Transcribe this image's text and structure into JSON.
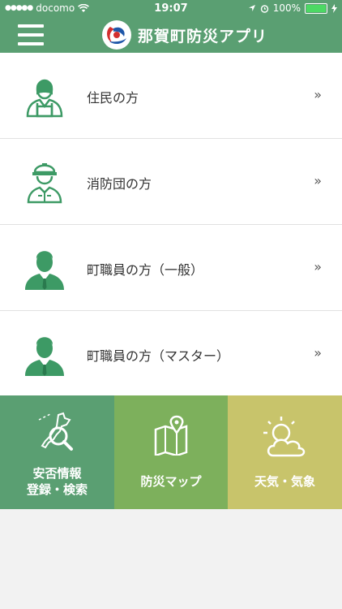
{
  "status_bar": {
    "carrier": "docomo",
    "time": "19:07",
    "battery": "100%"
  },
  "header": {
    "title": "那賀町防災アプリ"
  },
  "list_items": [
    {
      "label": "住民の方",
      "chevron": "»",
      "icon": "resident-icon"
    },
    {
      "label": "消防団の方",
      "chevron": "»",
      "icon": "firefighter-icon"
    },
    {
      "label": "町職員の方（一般）",
      "chevron": "»",
      "icon": "staff-icon"
    },
    {
      "label": "町職員の方（マスター）",
      "chevron": "»",
      "icon": "staff-master-icon"
    }
  ],
  "tiles": [
    {
      "line1": "安否情報",
      "line2": "登録・検索",
      "icon": "map-search-icon",
      "color": "#5a9f72"
    },
    {
      "line1": "防災マップ",
      "icon": "map-pin-icon",
      "color": "#7db05c"
    },
    {
      "line1": "天気・気象",
      "icon": "weather-icon",
      "color": "#c8c46b"
    }
  ],
  "colors": {
    "header": "#5a9f72",
    "icon_green": "#3d9a65"
  }
}
